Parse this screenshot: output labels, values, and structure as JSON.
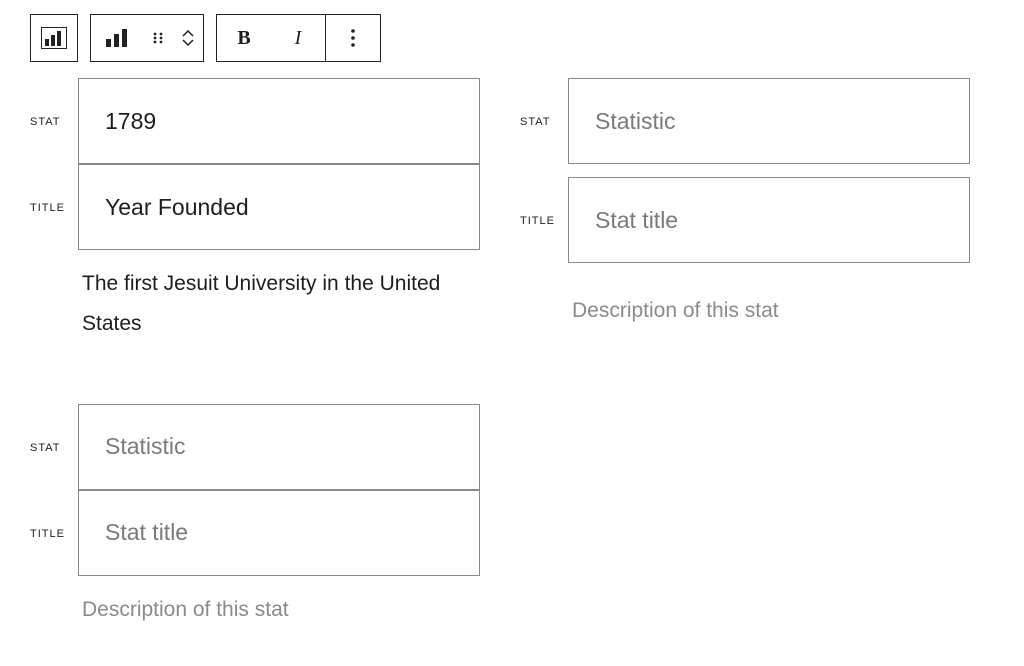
{
  "toolbar": {
    "block_icon": "stats-block",
    "inner_icon": "bar-chart",
    "bold_label": "B",
    "italic_label": "I"
  },
  "labels": {
    "stat": "STAT",
    "title": "TITLE"
  },
  "placeholders": {
    "stat": "Statistic",
    "title": "Stat title",
    "desc": "Description of this stat"
  },
  "stats": [
    {
      "stat": "1789",
      "title": "Year Founded",
      "desc": "The first Jesuit University in the United States",
      "stat_is_placeholder": false,
      "title_is_placeholder": false,
      "desc_is_placeholder": false
    },
    {
      "stat": "",
      "title": "",
      "desc": "",
      "stat_is_placeholder": true,
      "title_is_placeholder": true,
      "desc_is_placeholder": true
    },
    {
      "stat": "",
      "title": "",
      "desc": "",
      "stat_is_placeholder": true,
      "title_is_placeholder": true,
      "desc_is_placeholder": true
    }
  ]
}
